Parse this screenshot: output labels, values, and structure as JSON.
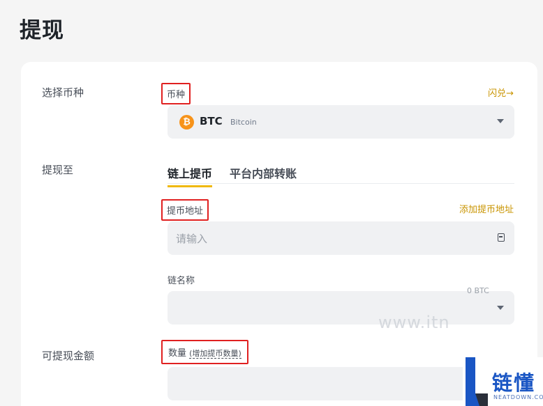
{
  "page": {
    "title": "提现"
  },
  "section_coin": {
    "row_label": "选择币种",
    "field_label": "币种",
    "swap_link": "闪兑→",
    "selected_coin": {
      "symbol": "BTC",
      "name": "Bitcoin",
      "icon": "bitcoin-icon",
      "icon_glyph": "₿",
      "icon_color": "#f7931a"
    }
  },
  "section_withdraw_to": {
    "row_label": "提现至",
    "tabs": [
      {
        "label": "链上提币",
        "active": true
      },
      {
        "label": "平台内部转账",
        "active": false
      }
    ],
    "address_label": "提币地址",
    "add_address_link": "添加提币地址",
    "address_placeholder": "请输入",
    "network_label": "链名称"
  },
  "section_amount": {
    "row_label": "可提现金额",
    "field_label": "数量",
    "increase_link": "(增加提币数量)",
    "available_hint": "0 BTC"
  },
  "watermark": {
    "site_text": "www.itn",
    "logo_text": "链懂",
    "logo_sub": "NEATDOWN.COM"
  },
  "colors": {
    "accent": "#f0b90b",
    "link": "#c99400",
    "highlight_box": "#e02020"
  }
}
